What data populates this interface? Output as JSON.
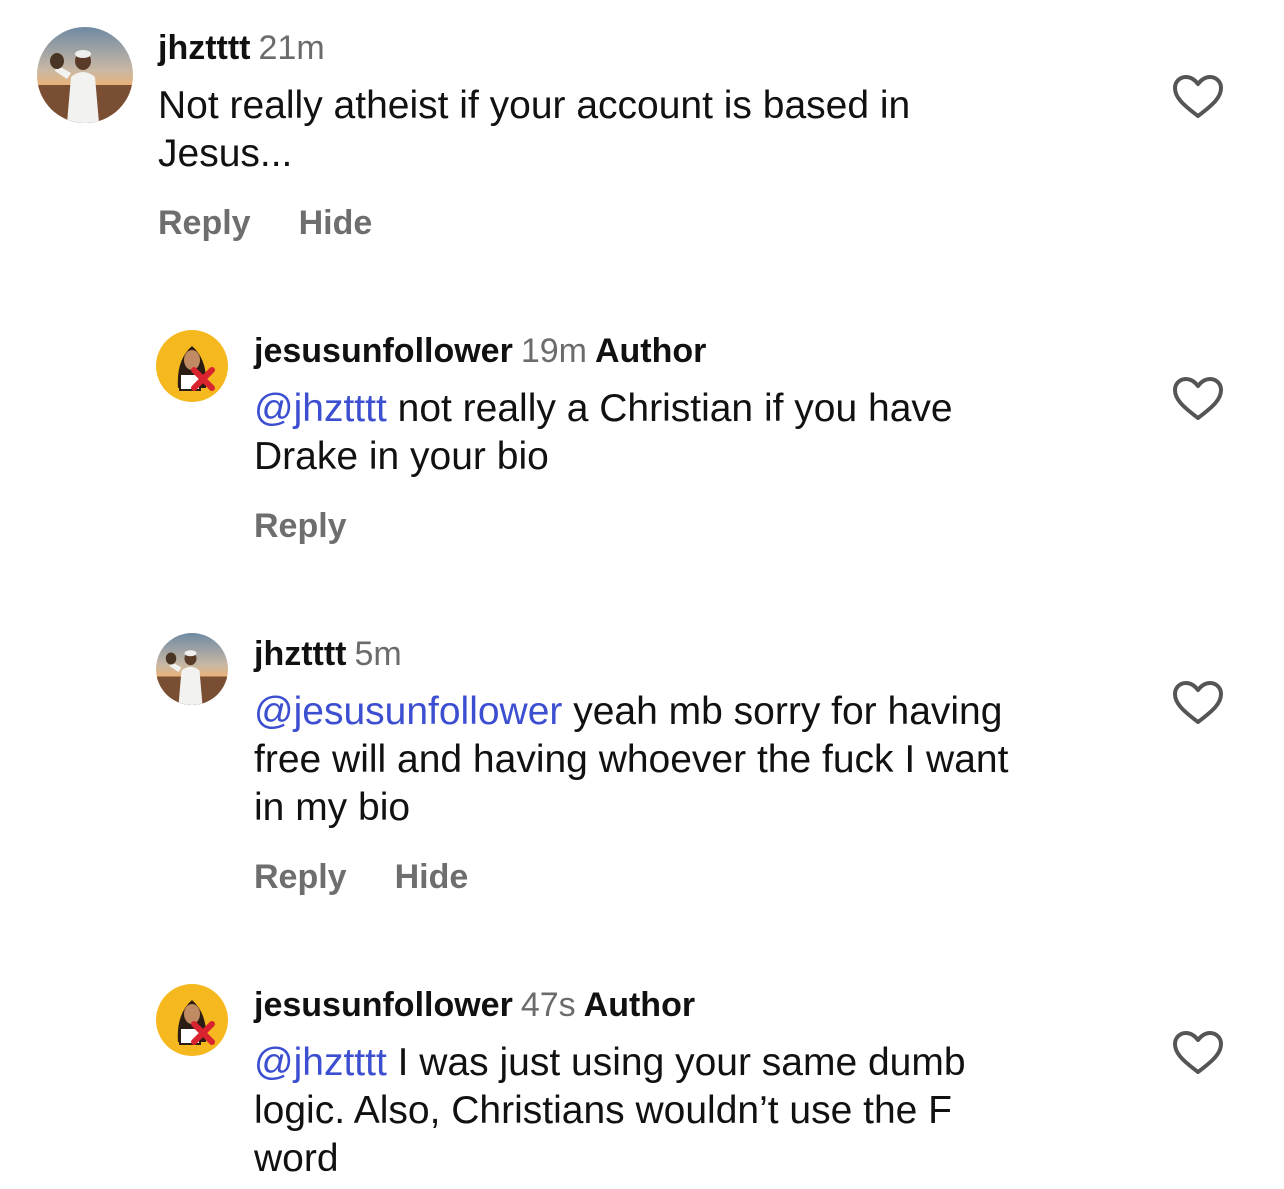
{
  "comments": [
    {
      "username": "jhztttt",
      "time": "21m",
      "author_tag": "",
      "mention": "",
      "text": "Not really atheist if your account is based in",
      "text2": "Jesus...",
      "reply_label": "Reply",
      "hide_label": "Hide",
      "avatar_icon": "falconer-photo-avatar",
      "like_icon": "heart-outline-icon"
    },
    {
      "username": "jesusunfollower",
      "time": "19m",
      "author_tag": "Author",
      "mention": "@jhztttt",
      "text": " not really a Christian if you have",
      "text2": "Drake in your bio",
      "reply_label": "Reply",
      "avatar_icon": "jesus-unfollow-avatar",
      "like_icon": "heart-outline-icon"
    },
    {
      "username": "jhztttt",
      "time": "5m",
      "author_tag": "",
      "mention": "@jesusunfollower",
      "text": " yeah mb sorry for having",
      "text2": "free will and having whoever the fuck I want",
      "text3": "in my bio",
      "reply_label": "Reply",
      "hide_label": "Hide",
      "avatar_icon": "falconer-photo-avatar",
      "like_icon": "heart-outline-icon"
    },
    {
      "username": "jesusunfollower",
      "time": "47s",
      "author_tag": "Author",
      "mention": "@jhztttt",
      "text": " I was just using your same dumb",
      "text2": "logic. Also, Christians wouldn’t use the F",
      "text3": "word",
      "avatar_icon": "jesus-unfollow-avatar",
      "like_icon": "heart-outline-icon"
    }
  ],
  "colors": {
    "mention": "#3b4fd0",
    "secondary_text": "#6e6e6e",
    "avatar_yellow": "#f5b81f",
    "unfollow_red": "#d9232e"
  }
}
